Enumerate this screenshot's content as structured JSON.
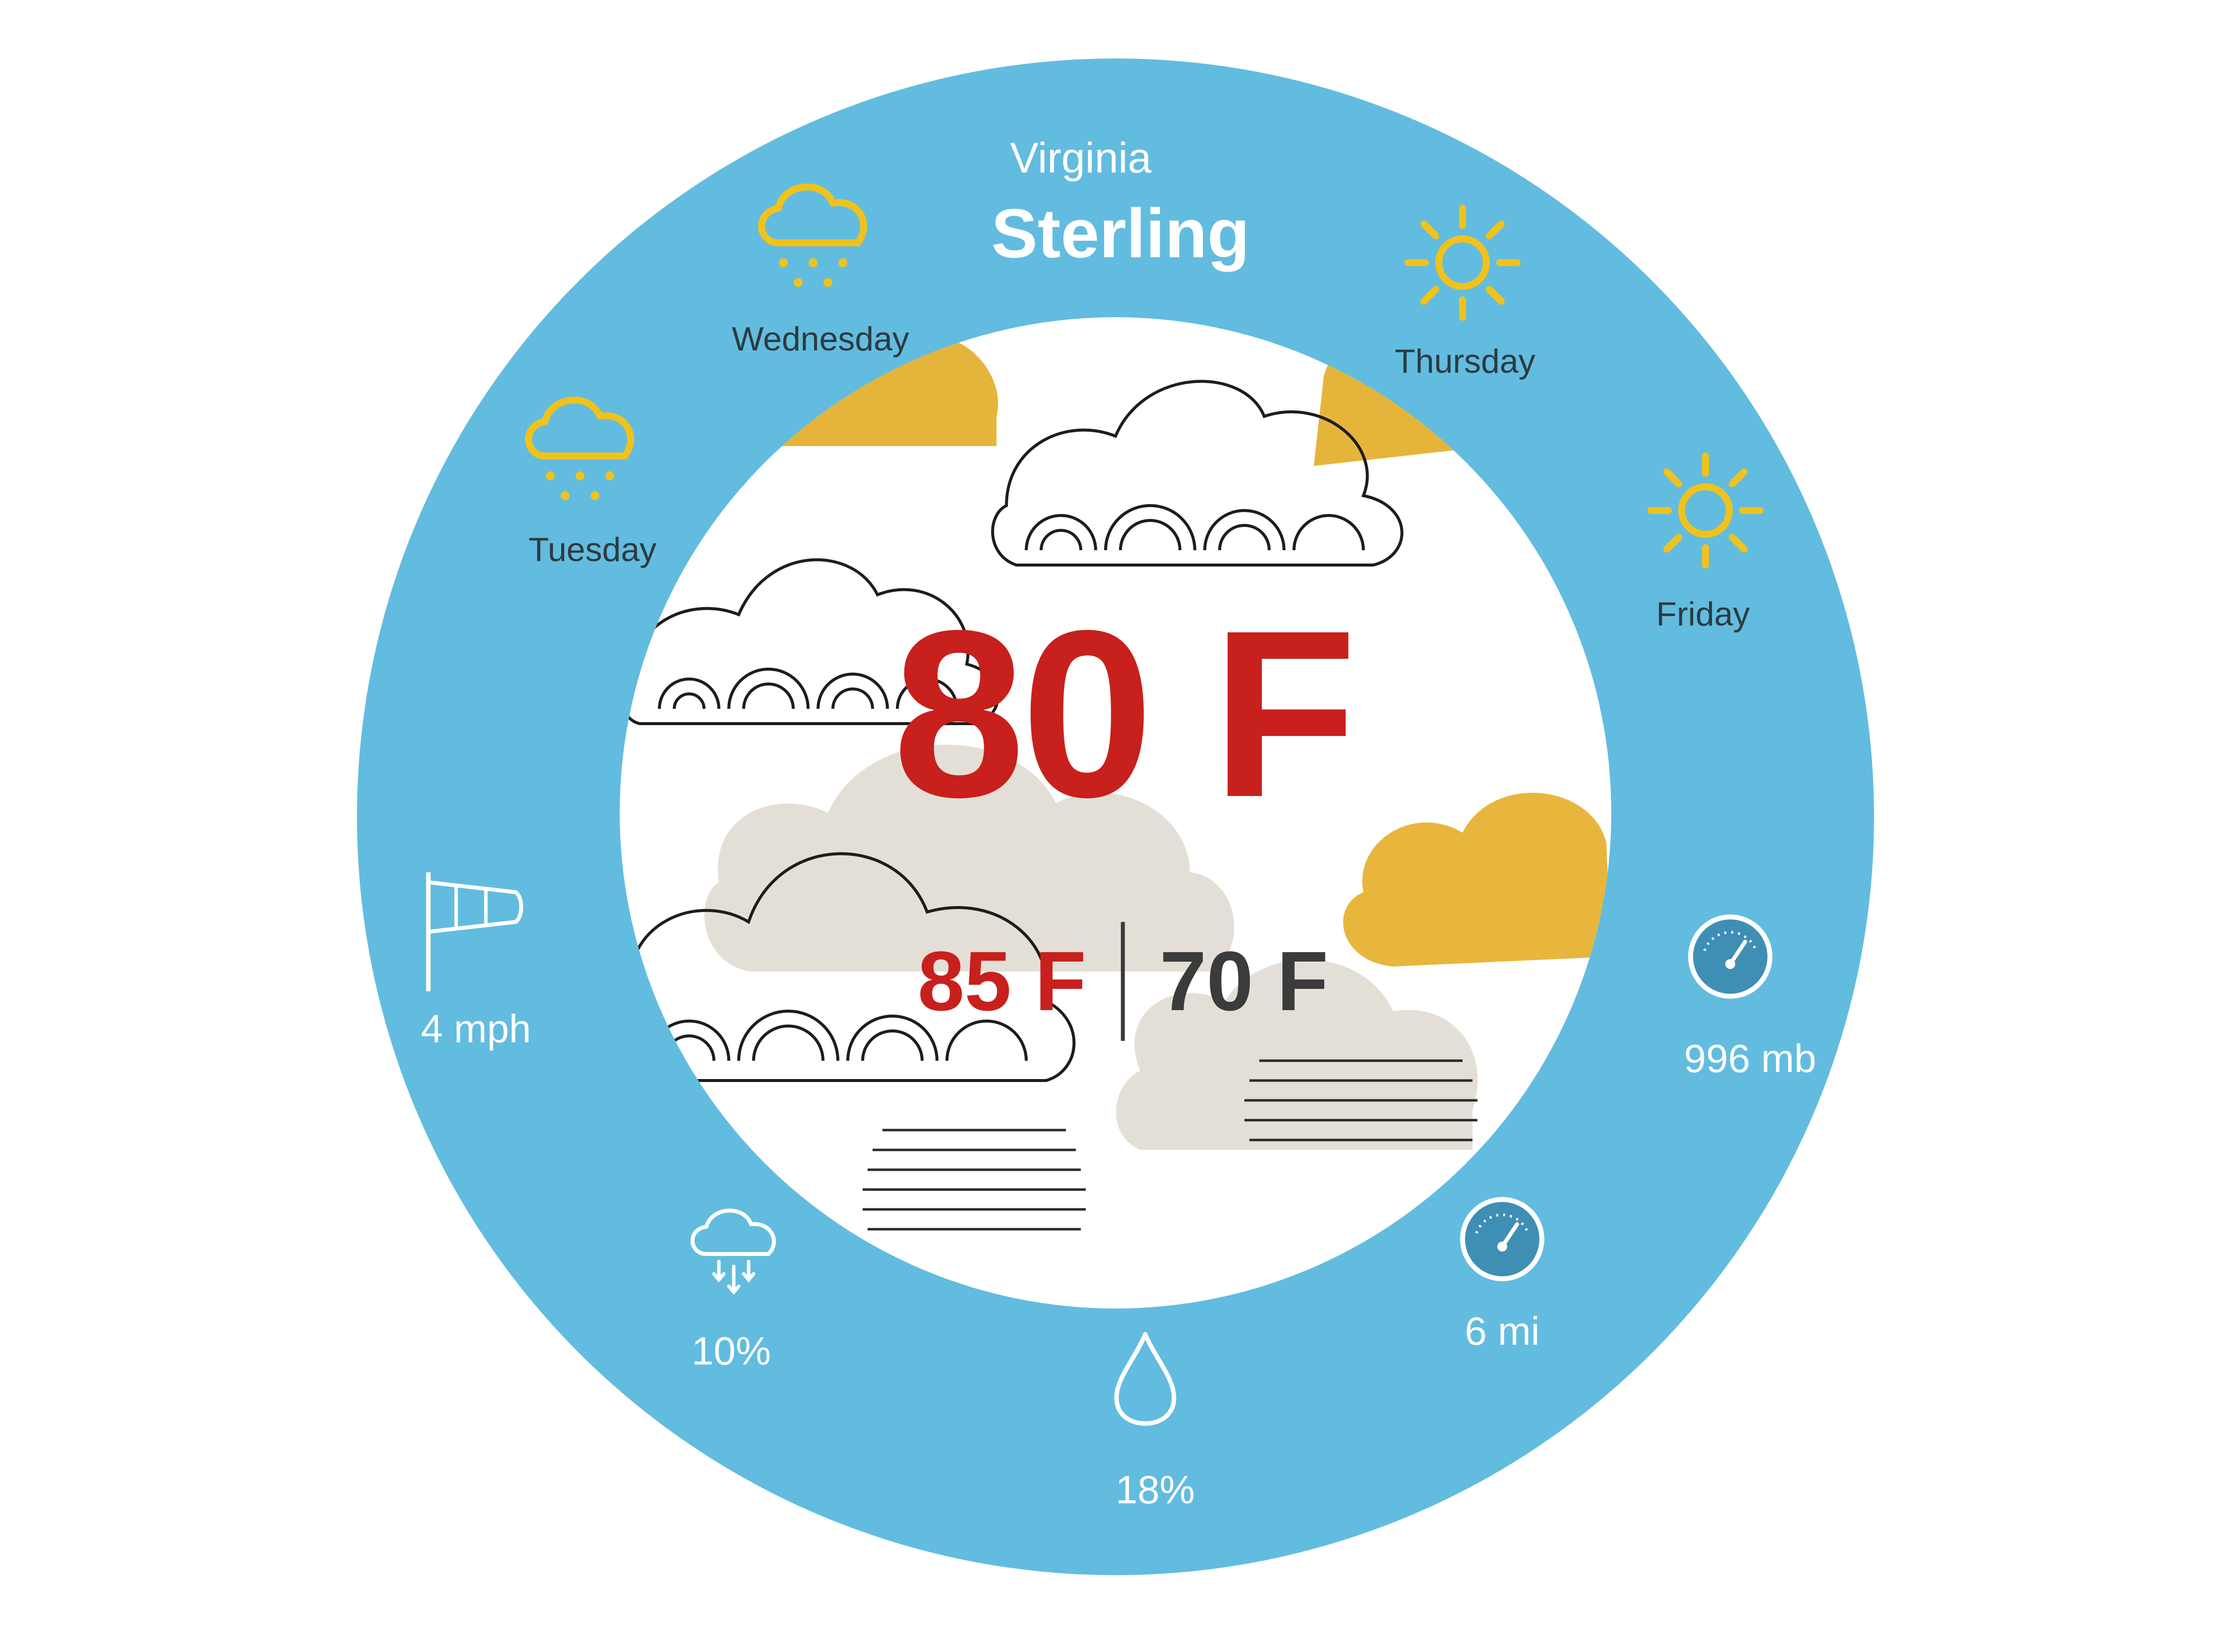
{
  "location": {
    "state": "Virginia",
    "city": "Sterling"
  },
  "current": {
    "temperature": "80 F",
    "high": "85 F",
    "low": "70 F"
  },
  "forecast": [
    {
      "day": "Tuesday",
      "icon": "rain-cloud-icon"
    },
    {
      "day": "Wednesday",
      "icon": "rain-cloud-icon"
    },
    {
      "day": "Thursday",
      "icon": "sun-icon"
    },
    {
      "day": "Friday",
      "icon": "sun-icon"
    }
  ],
  "stats": {
    "wind": {
      "value": "4 mph",
      "icon": "windsock-icon"
    },
    "precipitation": {
      "value": "10%",
      "icon": "precipitation-cloud-icon"
    },
    "humidity": {
      "value": "18%",
      "icon": "water-drop-icon"
    },
    "visibility": {
      "value": "6 mi",
      "icon": "gauge-icon"
    },
    "pressure": {
      "value": "996 mb",
      "icon": "gauge-icon"
    }
  },
  "colors": {
    "ring": "#62bcdf",
    "temperature": "#c8201c",
    "icon_yellow": "#f1c21b",
    "gauge_blue": "#3f8fb5"
  }
}
